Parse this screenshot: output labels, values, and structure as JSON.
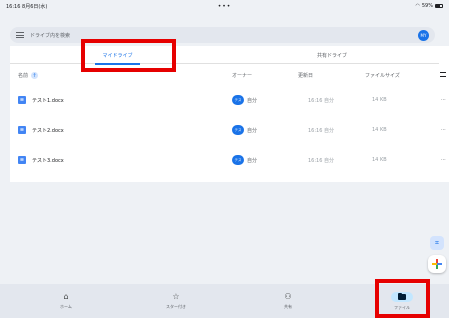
{
  "status_bar": {
    "time": "16:16",
    "date": "8月6日(水)",
    "dots": "•••",
    "battery": "59%"
  },
  "search": {
    "placeholder": "ドライブ内を検索",
    "avatar_initials": "MY"
  },
  "tabs": [
    {
      "label": "マイドライブ",
      "active": true
    },
    {
      "label": "共有ドライブ",
      "active": false
    }
  ],
  "columns": {
    "name": "名前",
    "sort_arrow": "↑",
    "owner": "オーナー",
    "modified": "更新日",
    "size": "ファイルサイズ"
  },
  "files": [
    {
      "name": "テスト1.docx",
      "owner_initials": "テス",
      "owner": "自分",
      "modified": "16:16 自分",
      "size": "14 KB",
      "icon": "docs-icon"
    },
    {
      "name": "テスト2.docx",
      "owner_initials": "テス",
      "owner": "自分",
      "modified": "16:16 自分",
      "size": "14 KB",
      "icon": "docs-icon"
    },
    {
      "name": "テスト3.docx",
      "owner_initials": "テス",
      "owner": "自分",
      "modified": "16:16 自分",
      "size": "14 KB",
      "icon": "docs-icon"
    }
  ],
  "bottom_nav": [
    {
      "label": "ホーム",
      "icon": "home-icon",
      "active": false
    },
    {
      "label": "スター付き",
      "icon": "star-icon",
      "active": false
    },
    {
      "label": "共有",
      "icon": "shared-icon",
      "active": false
    },
    {
      "label": "ファイル",
      "icon": "folder-icon",
      "active": true
    }
  ],
  "colors": {
    "accent": "#1a73e8",
    "highlight": "#e60000",
    "active_nav": "#c2e7ff"
  }
}
